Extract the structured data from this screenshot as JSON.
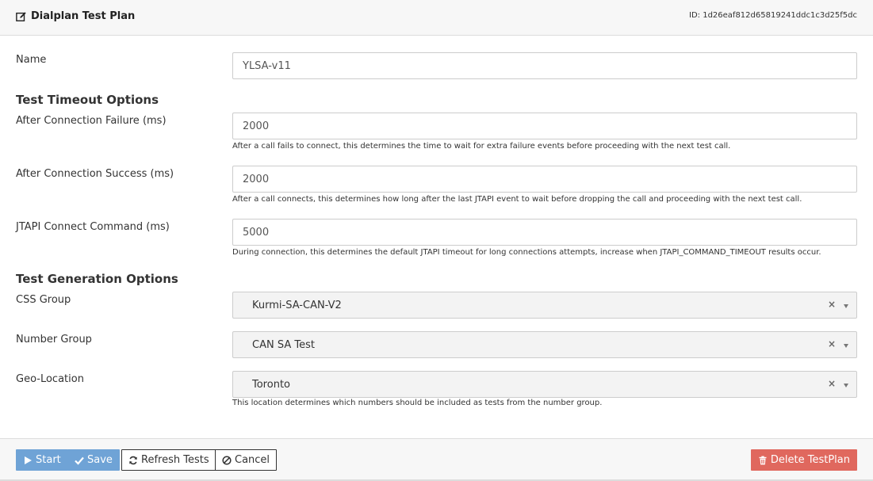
{
  "header": {
    "title": "Dialplan Test Plan",
    "id_text": "ID: 1d26eaf812d65819241ddc1c3d25f5dc"
  },
  "form": {
    "name": {
      "label": "Name",
      "value": "YLSA-v11"
    },
    "timeout_section": "Test Timeout Options",
    "after_failure": {
      "label": "After Connection Failure (ms)",
      "value": "2000",
      "help": "After a call fails to connect, this determines the time to wait for extra failure events before proceeding with the next test call."
    },
    "after_success": {
      "label": "After Connection Success (ms)",
      "value": "2000",
      "help": "After a call connects, this determines how long after the last JTAPI event to wait before dropping the call and proceeding with the next test call."
    },
    "jtapi_connect": {
      "label": "JTAPI Connect Command (ms)",
      "value": "5000",
      "help": "During connection, this determines the default JTAPI timeout for long connections attempts, increase when JTAPI_COMMAND_TIMEOUT results occur."
    },
    "generation_section": "Test Generation Options",
    "css_group": {
      "label": "CSS Group",
      "value": "Kurmi-SA-CAN-V2"
    },
    "number_group": {
      "label": "Number Group",
      "value": "CAN SA Test"
    },
    "geo_location": {
      "label": "Geo-Location",
      "value": "Toronto",
      "help": "This location determines which numbers should be included as tests from the number group."
    },
    "clear_glyph": "×"
  },
  "footer": {
    "start_label": "Start",
    "save_label": "Save",
    "refresh_label": "Refresh Tests",
    "cancel_label": "Cancel",
    "delete_label": "Delete TestPlan"
  },
  "colors": {
    "primary": "#6fa3d6",
    "danger": "#e0685e"
  }
}
